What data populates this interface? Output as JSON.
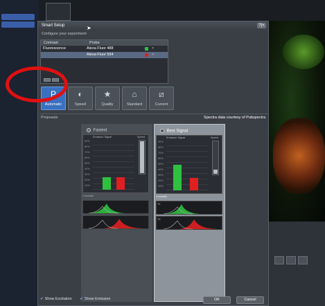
{
  "dialog": {
    "title": "Smart Setup",
    "subtitle": "Configure your experiment",
    "close_label": "?|×"
  },
  "table": {
    "headers": [
      "Contrast",
      "Probe"
    ],
    "rows": [
      {
        "contrast": "Fluorescence",
        "probe": "Alexa Fluor 488",
        "color": "#30c040"
      },
      {
        "contrast": "",
        "probe": "Alexa Fluor 594",
        "color": "#e02020"
      }
    ]
  },
  "modes": [
    {
      "label": "Automatic",
      "icon": "P"
    },
    {
      "label": "Speed",
      "icon": "◐"
    },
    {
      "label": "Quality",
      "icon": "★"
    },
    {
      "label": "Standard",
      "icon": "⌂"
    },
    {
      "label": "Current",
      "icon": "⧄"
    }
  ],
  "proposals_label": "Proposals",
  "courtesy": "Spectra data courtesy of Pubspectra",
  "panels": {
    "fastest": {
      "label": "Fastest",
      "signal_label": "Emission Signal",
      "speed_label": "Speed",
      "crosstalk_label": "Crosstalk",
      "yticks": [
        "90%",
        "80%",
        "70%",
        "60%",
        "50%",
        "40%",
        "30%",
        "20%",
        "10%"
      ],
      "bar_values": [
        0.25,
        0.25
      ],
      "speed_value": 0.95
    },
    "best": {
      "label": "Best Signal",
      "signal_label": "Emission Signal",
      "speed_label": "Speed",
      "crosstalk_label": "Crosstalk",
      "yticks": [
        "90%",
        "80%",
        "70%",
        "60%",
        "50%",
        "40%",
        "30%",
        "20%",
        "10%"
      ],
      "bar_values": [
        0.52,
        0.25
      ],
      "speed_value": 0.12
    }
  },
  "spectra_ticks": [
    "T1",
    "T2"
  ],
  "footer": {
    "show_excitation": "Show Excitation",
    "show_emission": "Show Emission",
    "ok": "OK",
    "cancel": "Cancel"
  },
  "colors": {
    "accent": "#3a70c0",
    "green": "#30c040",
    "red": "#e02020"
  }
}
